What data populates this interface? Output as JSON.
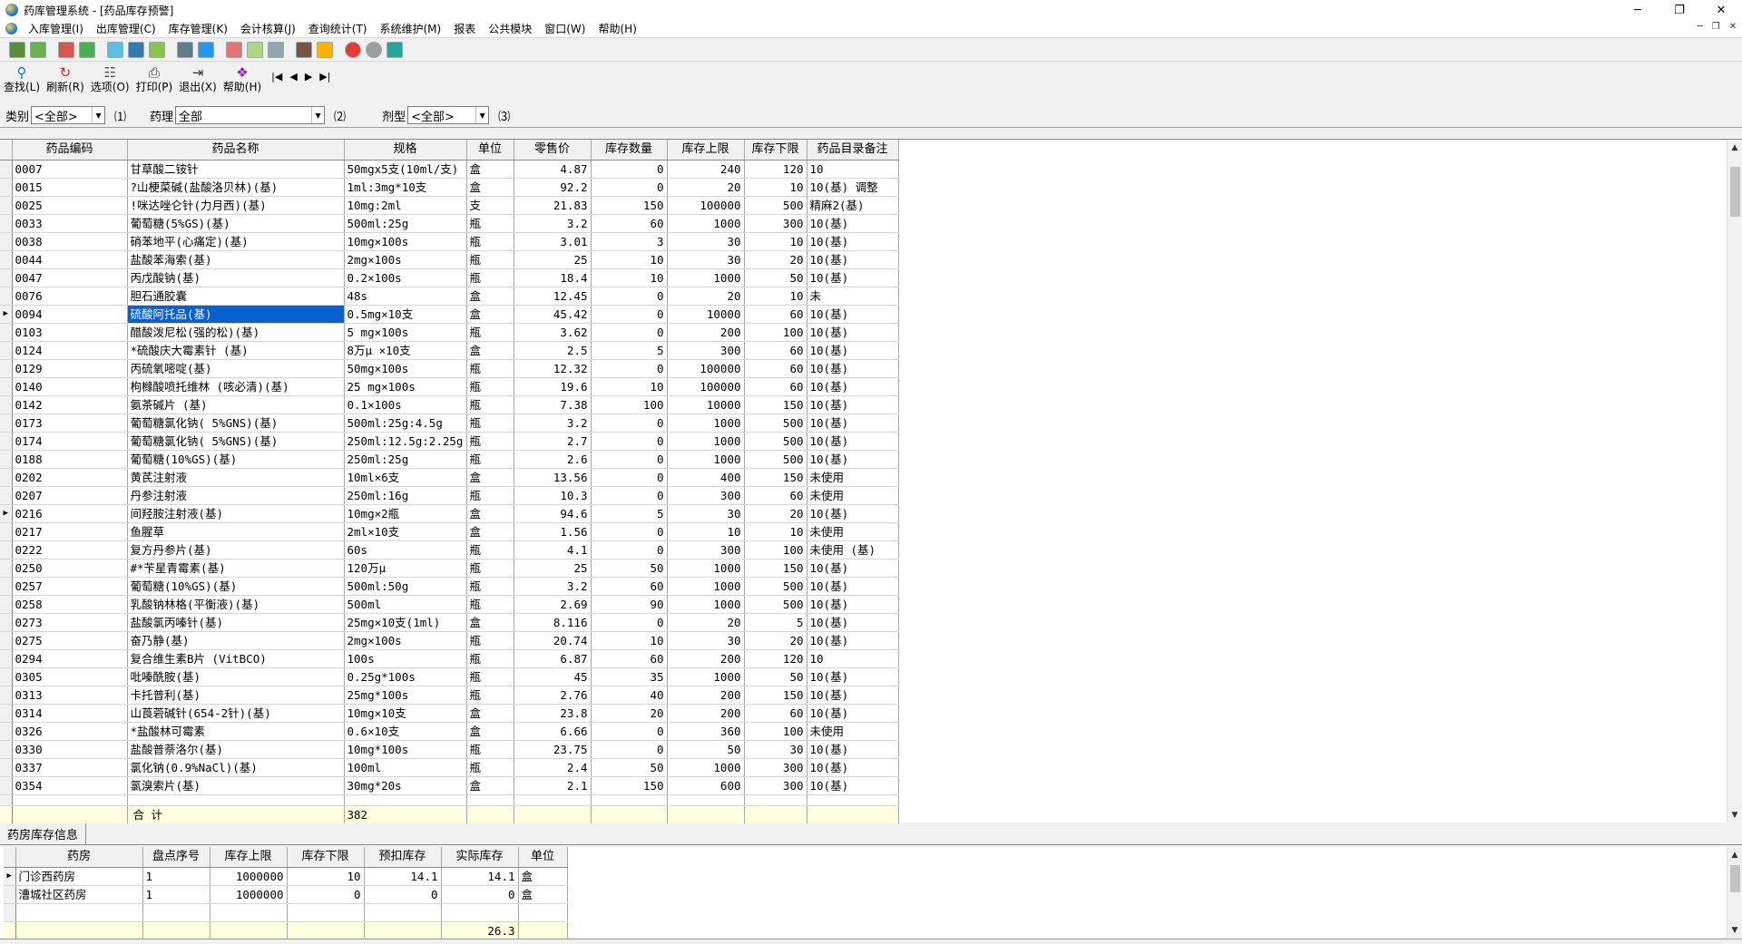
{
  "window": {
    "title": "药库管理系统 - [药品库存预警]",
    "controls": [
      "─",
      "❐",
      "✕"
    ]
  },
  "menu": [
    "入库管理(I)",
    "出库管理(C)",
    "库存管理(K)",
    "会计核算(J)",
    "查询统计(T)",
    "系统维护(M)",
    "报表",
    "公共模块",
    "窗口(W)",
    "帮助(H)"
  ],
  "toolbar": {
    "find": "查找(L)",
    "refresh": "刷新(R)",
    "options": "选项(O)",
    "print": "打印(P)",
    "exit": "退出(X)",
    "help": "帮助(H)"
  },
  "filters": {
    "category_label": "类别",
    "category_value": "<全部>",
    "hint1": "⑴",
    "pharm_label": "药理",
    "pharm_value": "全部",
    "hint2": "⑵",
    "form_label": "剂型",
    "form_value": "<全部>",
    "hint3": "⑶"
  },
  "grid": {
    "columns": [
      "药品编码",
      "药品名称",
      "规格",
      "单位",
      "零售价",
      "库存数量",
      "库存上限",
      "库存下限",
      "药品目录备注"
    ],
    "rows": [
      [
        "0007",
        "甘草酸二铵针",
        "50mgx5支(10ml/支)",
        "盒",
        "4.87",
        "0",
        "240",
        "120",
        "10"
      ],
      [
        "0015",
        "?山梗菜碱(盐酸洛贝林)(基)",
        "1ml:3mg*10支",
        "盒",
        "92.2",
        "0",
        "20",
        "10",
        "10(基) 调整"
      ],
      [
        "0025",
        "!咪达唑仑针(力月西)(基)",
        "10mg:2ml",
        "支",
        "21.83",
        "150",
        "100000",
        "500",
        "精麻2(基)"
      ],
      [
        "0033",
        "葡萄糖(5%GS)(基)",
        "500ml:25g",
        "瓶",
        "3.2",
        "60",
        "1000",
        "300",
        "10(基)"
      ],
      [
        "0038",
        "硝苯地平(心痛定)(基)",
        "10mg×100s",
        "瓶",
        "3.01",
        "3",
        "30",
        "10",
        "10(基)"
      ],
      [
        "0044",
        "盐酸苯海索(基)",
        "2mg×100s",
        "瓶",
        "25",
        "10",
        "30",
        "20",
        "10(基)"
      ],
      [
        "0047",
        "丙戊酸钠(基)",
        "0.2×100s",
        "瓶",
        "18.4",
        "10",
        "1000",
        "50",
        "10(基)"
      ],
      [
        "0076",
        "胆石通胶囊",
        "48s",
        "盒",
        "12.45",
        "0",
        "20",
        "10",
        "未"
      ],
      [
        "0094",
        "硫酸阿托品(基)",
        "0.5mg×10支",
        "盒",
        "45.42",
        "0",
        "10000",
        "60",
        "10(基)"
      ],
      [
        "0103",
        "醋酸泼尼松(强的松)(基)",
        "5 mg×100s",
        "瓶",
        "3.62",
        "0",
        "200",
        "100",
        "10(基)"
      ],
      [
        "0124",
        "*硫酸庆大霉素针 (基)",
        "8万μ ×10支",
        "盒",
        "2.5",
        "5",
        "300",
        "60",
        "10(基)"
      ],
      [
        "0129",
        "丙硫氧嘧啶(基)",
        "50mg×100s",
        "瓶",
        "12.32",
        "0",
        "100000",
        "60",
        "10(基)"
      ],
      [
        "0140",
        "枸橼酸喷托维林 (咳必清)(基)",
        "25 mg×100s",
        "瓶",
        "19.6",
        "10",
        "100000",
        "60",
        "10(基)"
      ],
      [
        "0142",
        "氨茶碱片 (基)",
        "0.1×100s",
        "瓶",
        "7.38",
        "100",
        "10000",
        "150",
        "10(基)"
      ],
      [
        "0173",
        "葡萄糖氯化钠( 5%GNS)(基)",
        "500ml:25g:4.5g",
        "瓶",
        "3.2",
        "0",
        "1000",
        "500",
        "10(基)"
      ],
      [
        "0174",
        "葡萄糖氯化钠( 5%GNS)(基)",
        "250ml:12.5g:2.25g",
        "瓶",
        "2.7",
        "0",
        "1000",
        "500",
        "10(基)"
      ],
      [
        "0188",
        "葡萄糖(10%GS)(基)",
        "250ml:25g",
        "瓶",
        "2.6",
        "0",
        "1000",
        "500",
        "10(基)"
      ],
      [
        "0202",
        "黄芪注射液",
        "10ml×6支",
        "盒",
        "13.56",
        "0",
        "400",
        "150",
        "未使用"
      ],
      [
        "0207",
        "丹参注射液",
        "250ml:16g",
        "瓶",
        "10.3",
        "0",
        "300",
        "60",
        "未使用"
      ],
      [
        "0216",
        "间羟胺注射液(基)",
        "10mg×2瓶",
        "盒",
        "94.6",
        "5",
        "30",
        "20",
        "10(基)"
      ],
      [
        "0217",
        "鱼腥草",
        "2ml×10支",
        "盒",
        "1.56",
        "0",
        "10",
        "10",
        "未使用"
      ],
      [
        "0222",
        "复方丹参片(基)",
        "60s",
        "瓶",
        "4.1",
        "0",
        "300",
        "100",
        "未使用 (基)"
      ],
      [
        "0250",
        "#*苄星青霉素(基)",
        "120万μ",
        "瓶",
        "25",
        "50",
        "1000",
        "150",
        "10(基)"
      ],
      [
        "0257",
        "葡萄糖(10%GS)(基)",
        "500ml:50g",
        "瓶",
        "3.2",
        "60",
        "1000",
        "500",
        "10(基)"
      ],
      [
        "0258",
        "乳酸钠林格(平衡液)(基)",
        "500ml",
        "瓶",
        "2.69",
        "90",
        "1000",
        "500",
        "10(基)"
      ],
      [
        "0273",
        "盐酸氯丙嗪针(基)",
        "25mg×10支(1ml)",
        "盒",
        "8.116",
        "0",
        "20",
        "5",
        "10(基)"
      ],
      [
        "0275",
        "奋乃静(基)",
        "2mg×100s",
        "瓶",
        "20.74",
        "10",
        "30",
        "20",
        "10(基)"
      ],
      [
        "0294",
        "复合维生素B片 (VitBCO)",
        "100s",
        "瓶",
        "6.87",
        "60",
        "200",
        "120",
        "10"
      ],
      [
        "0305",
        "吡嗪酰胺(基)",
        "0.25g*100s",
        "瓶",
        "45",
        "35",
        "1000",
        "50",
        "10(基)"
      ],
      [
        "0313",
        "卡托普利(基)",
        "25mg*100s",
        "瓶",
        "2.76",
        "40",
        "200",
        "150",
        "10(基)"
      ],
      [
        "0314",
        "山莨菪碱针(654-2针)(基)",
        "10mg×10支",
        "盒",
        "23.8",
        "20",
        "200",
        "60",
        "10(基)"
      ],
      [
        "0326",
        "*盐酸林可霉素",
        "0.6×10支",
        "盒",
        "6.66",
        "0",
        "360",
        "100",
        "未使用"
      ],
      [
        "0330",
        "盐酸普萘洛尔(基)",
        "10mg*100s",
        "瓶",
        "23.75",
        "0",
        "50",
        "30",
        "10(基)"
      ],
      [
        "0337",
        "氯化钠(0.9%NaCl)(基)",
        "100ml",
        "瓶",
        "2.4",
        "50",
        "1000",
        "300",
        "10(基)"
      ],
      [
        "0354",
        "氯溴索片(基)",
        "30mg*20s",
        "盒",
        "2.1",
        "150",
        "600",
        "300",
        "10(基)"
      ]
    ],
    "total_label": "合  计",
    "total_value": "382"
  },
  "subtab_label": "药房库存信息",
  "subgrid": {
    "columns": [
      "药房",
      "盘点序号",
      "库存上限",
      "库存下限",
      "预扣库存",
      "实际库存",
      "单位"
    ],
    "rows": [
      [
        "门诊西药房",
        "1",
        "1000000",
        "10",
        "14.1",
        "14.1",
        "盒"
      ],
      [
        "漕城社区药房",
        "1",
        "1000000",
        "0",
        "0",
        "0",
        "盒"
      ]
    ],
    "total_value": "26.3"
  }
}
